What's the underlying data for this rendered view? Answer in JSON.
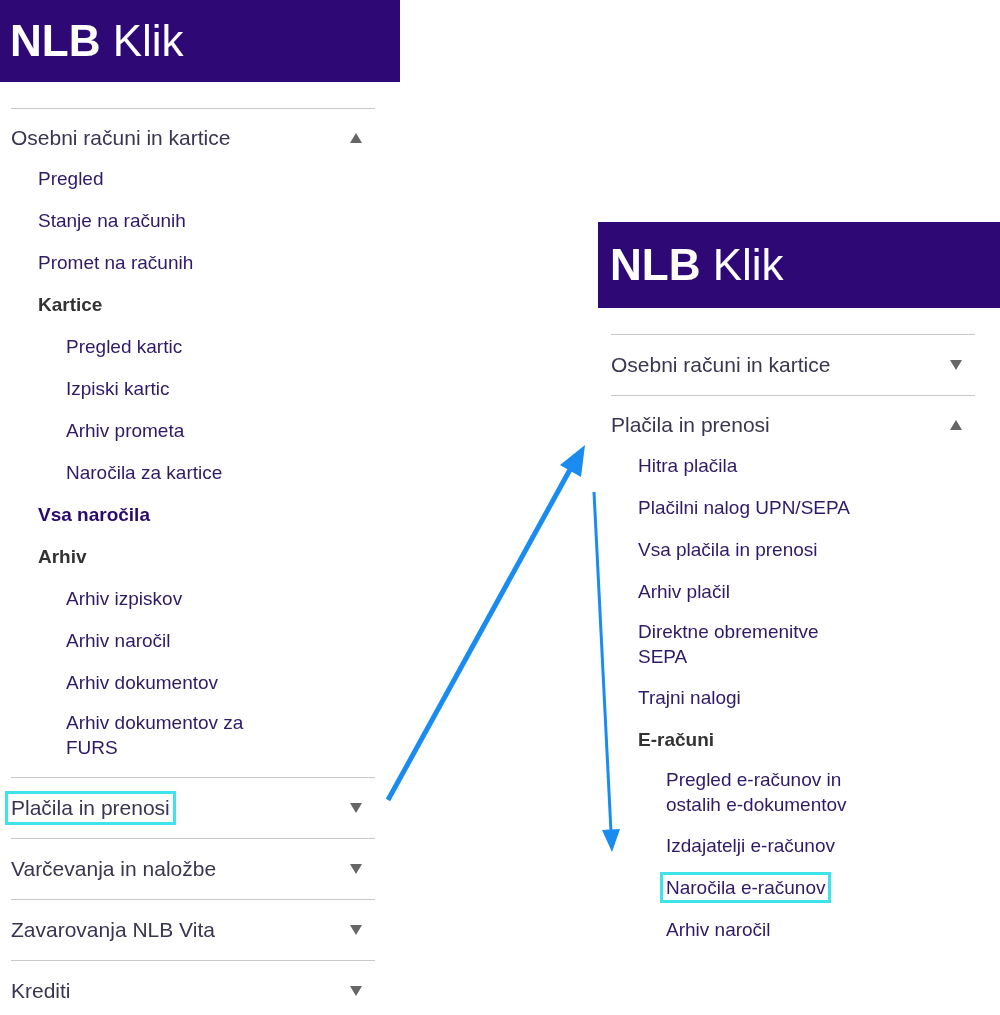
{
  "panels": [
    {
      "logo": "**NLB** Klik",
      "sections": [
        {
          "title": "Osebni računi in kartice",
          "expanded": true,
          "highlighted": false,
          "items": [
            {
              "label": "Pregled",
              "kind": "link",
              "highlighted": false
            },
            {
              "label": "Stanje na računih",
              "kind": "link",
              "highlighted": false
            },
            {
              "label": "Promet na računih",
              "kind": "link",
              "highlighted": false
            },
            {
              "label": "Kartice",
              "kind": "heading",
              "highlighted": false,
              "children": [
                {
                  "label": "Pregled kartic",
                  "kind": "link",
                  "highlighted": false
                },
                {
                  "label": "Izpiski kartic",
                  "kind": "link",
                  "highlighted": false
                },
                {
                  "label": "Arhiv prometa",
                  "kind": "link",
                  "highlighted": false
                },
                {
                  "label": "Naročila za kartice",
                  "kind": "link",
                  "highlighted": false
                }
              ]
            },
            {
              "label": "Vsa naročila",
              "kind": "current",
              "highlighted": false
            },
            {
              "label": "Arhiv",
              "kind": "heading",
              "highlighted": false,
              "children": [
                {
                  "label": "Arhiv izpiskov",
                  "kind": "link",
                  "highlighted": false
                },
                {
                  "label": "Arhiv naročil",
                  "kind": "link",
                  "highlighted": false
                },
                {
                  "label": "Arhiv dokumentov",
                  "kind": "link",
                  "highlighted": false
                },
                {
                  "label": "Arhiv dokumentov za FURS",
                  "kind": "link",
                  "highlighted": false
                }
              ]
            }
          ]
        },
        {
          "title": "Plačila in prenosi",
          "expanded": false,
          "highlighted": true
        },
        {
          "title": "Varčevanja in naložbe",
          "expanded": false,
          "highlighted": false
        },
        {
          "title": "Zavarovanja NLB Vita",
          "expanded": false,
          "highlighted": false
        },
        {
          "title": "Krediti",
          "expanded": false,
          "highlighted": false
        }
      ]
    },
    {
      "logo": "**NLB** Klik",
      "sections": [
        {
          "title": "Osebni računi in kartice",
          "expanded": false,
          "highlighted": false
        },
        {
          "title": "Plačila in prenosi",
          "expanded": true,
          "highlighted": false,
          "items": [
            {
              "label": "Hitra plačila",
              "kind": "link",
              "highlighted": false
            },
            {
              "label": "Plačilni nalog UPN/SEPA",
              "kind": "link",
              "highlighted": false
            },
            {
              "label": "Vsa plačila in prenosi",
              "kind": "link",
              "highlighted": false
            },
            {
              "label": "Arhiv plačil",
              "kind": "link",
              "highlighted": false
            },
            {
              "label": "Direktne obremenitve SEPA",
              "kind": "link",
              "highlighted": false
            },
            {
              "label": "Trajni nalogi",
              "kind": "link",
              "highlighted": false
            },
            {
              "label": "E-računi",
              "kind": "heading",
              "highlighted": false,
              "children": [
                {
                  "label": "Pregled e-računov in ostalih e-dokumentov",
                  "kind": "link",
                  "highlighted": false
                },
                {
                  "label": "Izdajatelji e-računov",
                  "kind": "link",
                  "highlighted": false
                },
                {
                  "label": "Naročila e-računov",
                  "kind": "link",
                  "highlighted": true
                },
                {
                  "label": "Arhiv naročil",
                  "kind": "link",
                  "highlighted": false
                }
              ]
            }
          ]
        }
      ]
    }
  ]
}
